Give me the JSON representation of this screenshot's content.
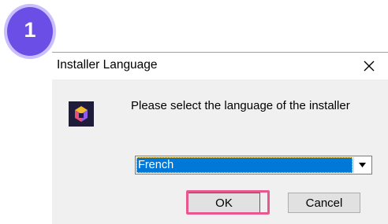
{
  "step_badge": {
    "number": "1",
    "color": "#6b4ee6"
  },
  "dialog": {
    "title": "Installer Language",
    "close_icon": "close-icon",
    "logo_icon": "app-logo-icon",
    "prompt": "Please select the language of the installer",
    "language_select": {
      "selected": "French"
    },
    "buttons": {
      "ok_label": "OK",
      "cancel_label": "Cancel"
    }
  },
  "colors": {
    "selection_blue": "#0078d7",
    "highlight_pink": "#e8588f",
    "dialog_body": "#f0f0f0"
  }
}
